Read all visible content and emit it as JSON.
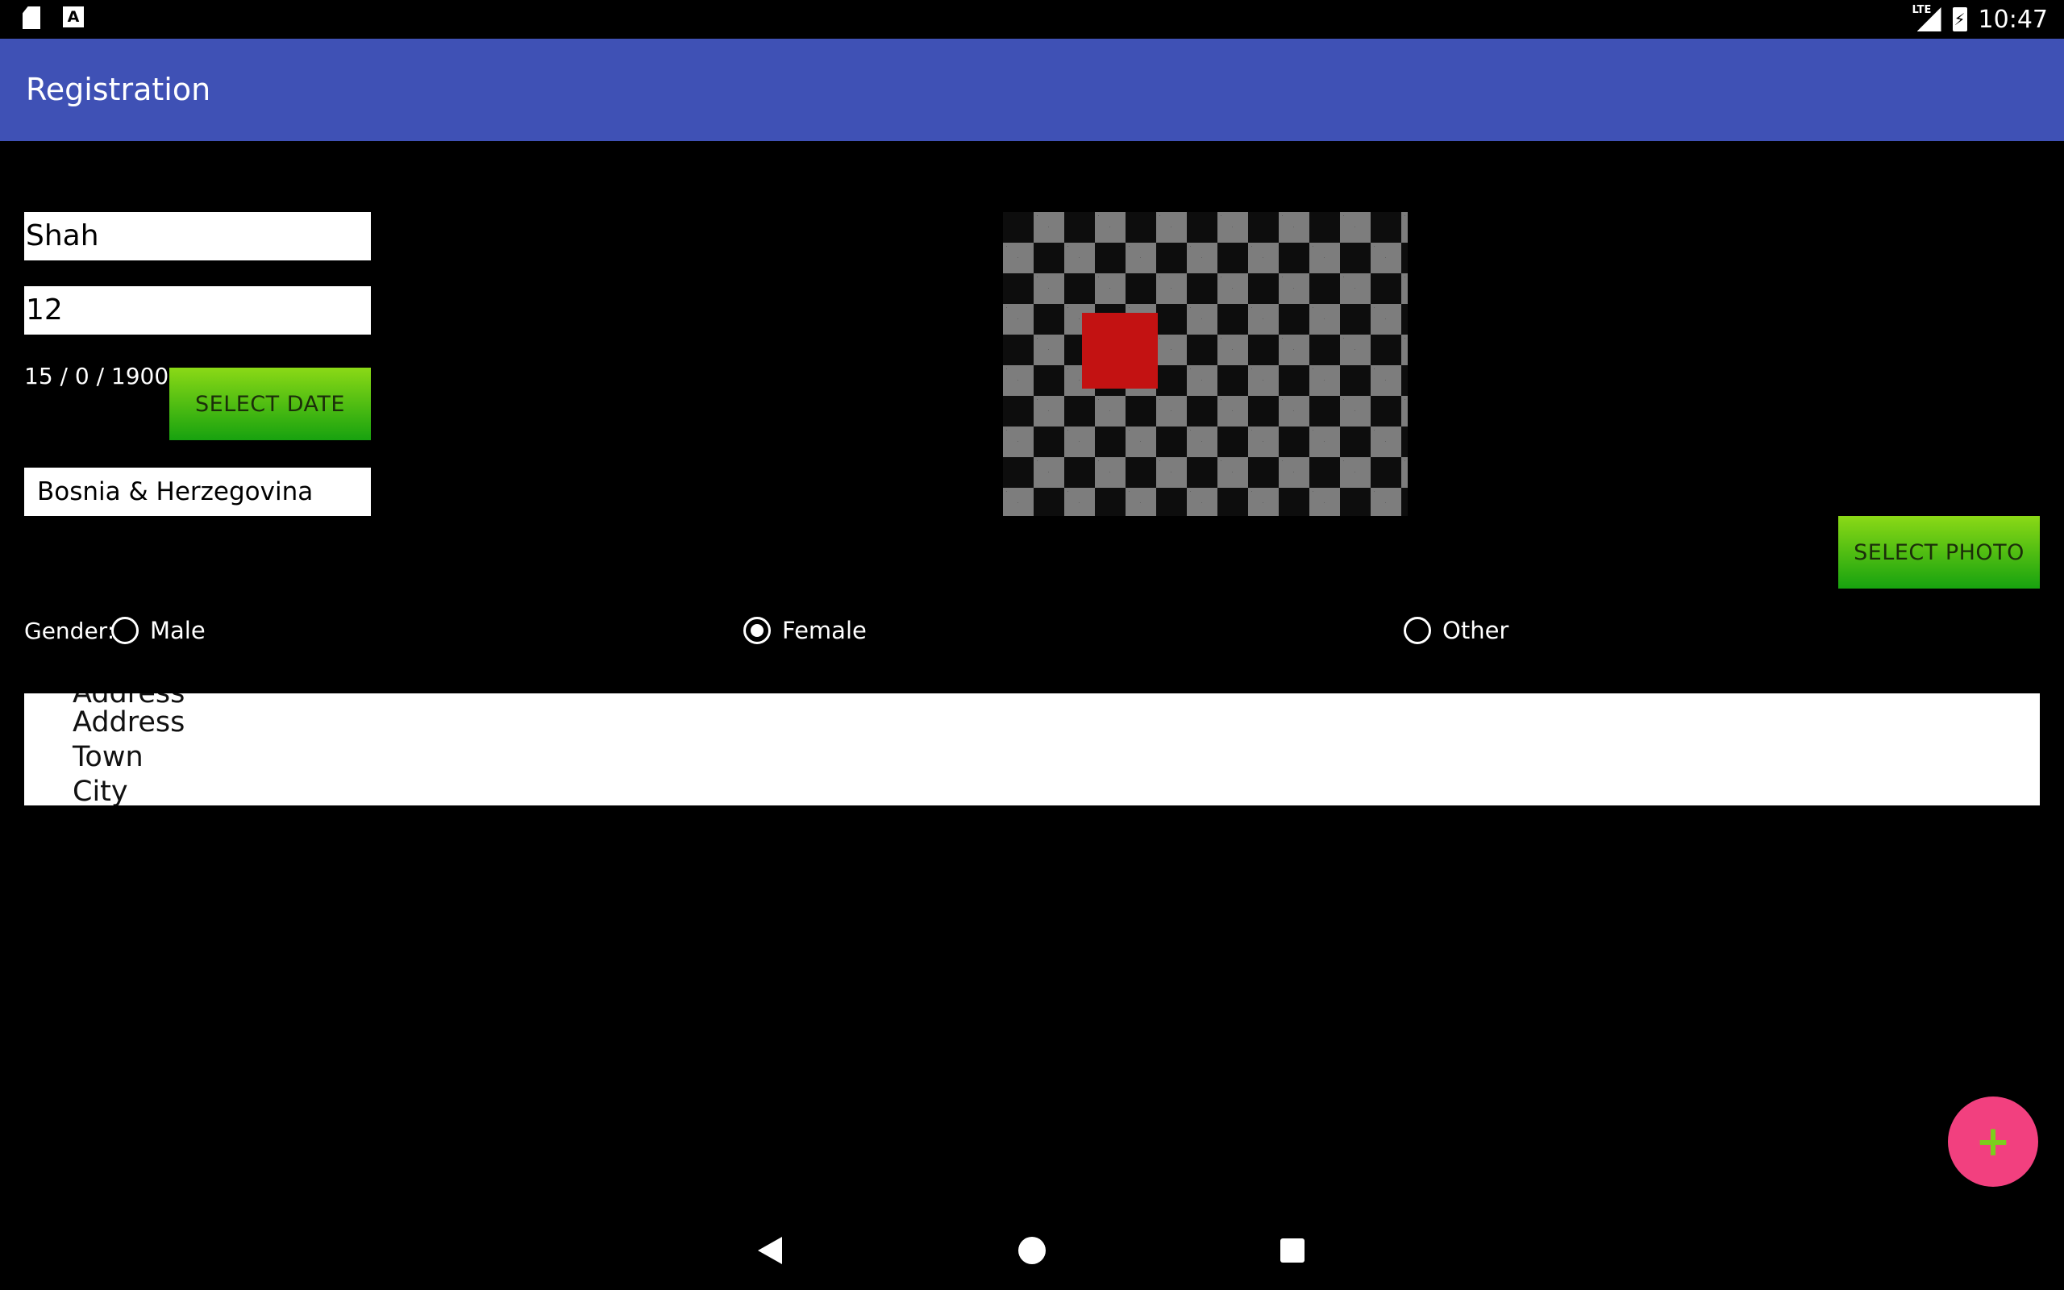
{
  "status_bar": {
    "icons": [
      "sd-card-icon",
      "a-notification-icon",
      "lte-signal-icon",
      "battery-charging-icon"
    ],
    "network": "LTE",
    "time": "10:47"
  },
  "app_bar": {
    "title": "Registration",
    "color": "#3f51b5"
  },
  "form": {
    "name_value": "Shah",
    "age_value": "12",
    "date_text": "15 / 0 / 1900",
    "select_date_label": "SELECT DATE",
    "country_value": "Bosnia & Herzegovina",
    "select_photo_label": "SELECT PHOTO",
    "gender_label": "Gender:",
    "gender_options": [
      {
        "label": "Male",
        "checked": false
      },
      {
        "label": "Female",
        "checked": true
      },
      {
        "label": "Other",
        "checked": false
      }
    ],
    "address_lines": [
      "Address",
      "Address",
      "Town",
      "City"
    ]
  },
  "fab": {
    "label": "+",
    "color": "#f2407f"
  },
  "nav_bar": {
    "icons": [
      "back-icon",
      "home-icon",
      "recent-apps-icon"
    ]
  },
  "colors": {
    "button_green_top": "#8bd916",
    "button_green_bottom": "#17a20f",
    "photo_red": "#c31212"
  }
}
